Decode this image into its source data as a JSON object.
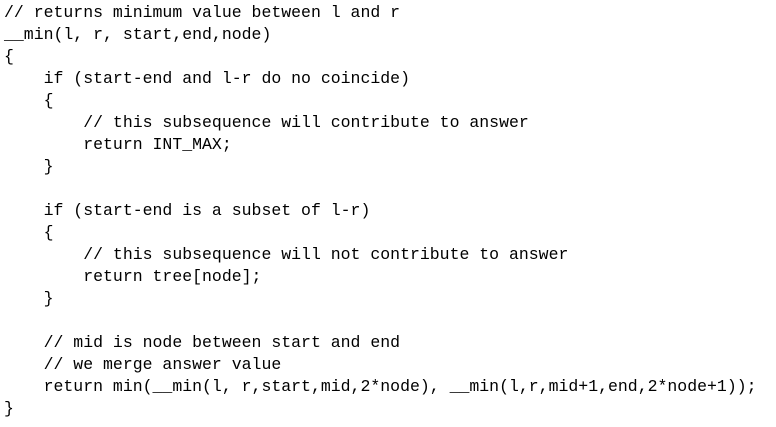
{
  "code_lines": [
    "// returns minimum value between l and r",
    "__min(l, r, start,end,node)",
    "{",
    "    if (start-end and l-r do no coincide)",
    "    {",
    "        // this subsequence will contribute to answer",
    "        return INT_MAX;",
    "    }",
    "",
    "    if (start-end is a subset of l-r)",
    "    {",
    "        // this subsequence will not contribute to answer",
    "        return tree[node];",
    "    }",
    "",
    "    // mid is node between start and end",
    "    // we merge answer value",
    "    return min(__min(l, r,start,mid,2*node), __min(l,r,mid+1,end,2*node+1));",
    "}"
  ]
}
